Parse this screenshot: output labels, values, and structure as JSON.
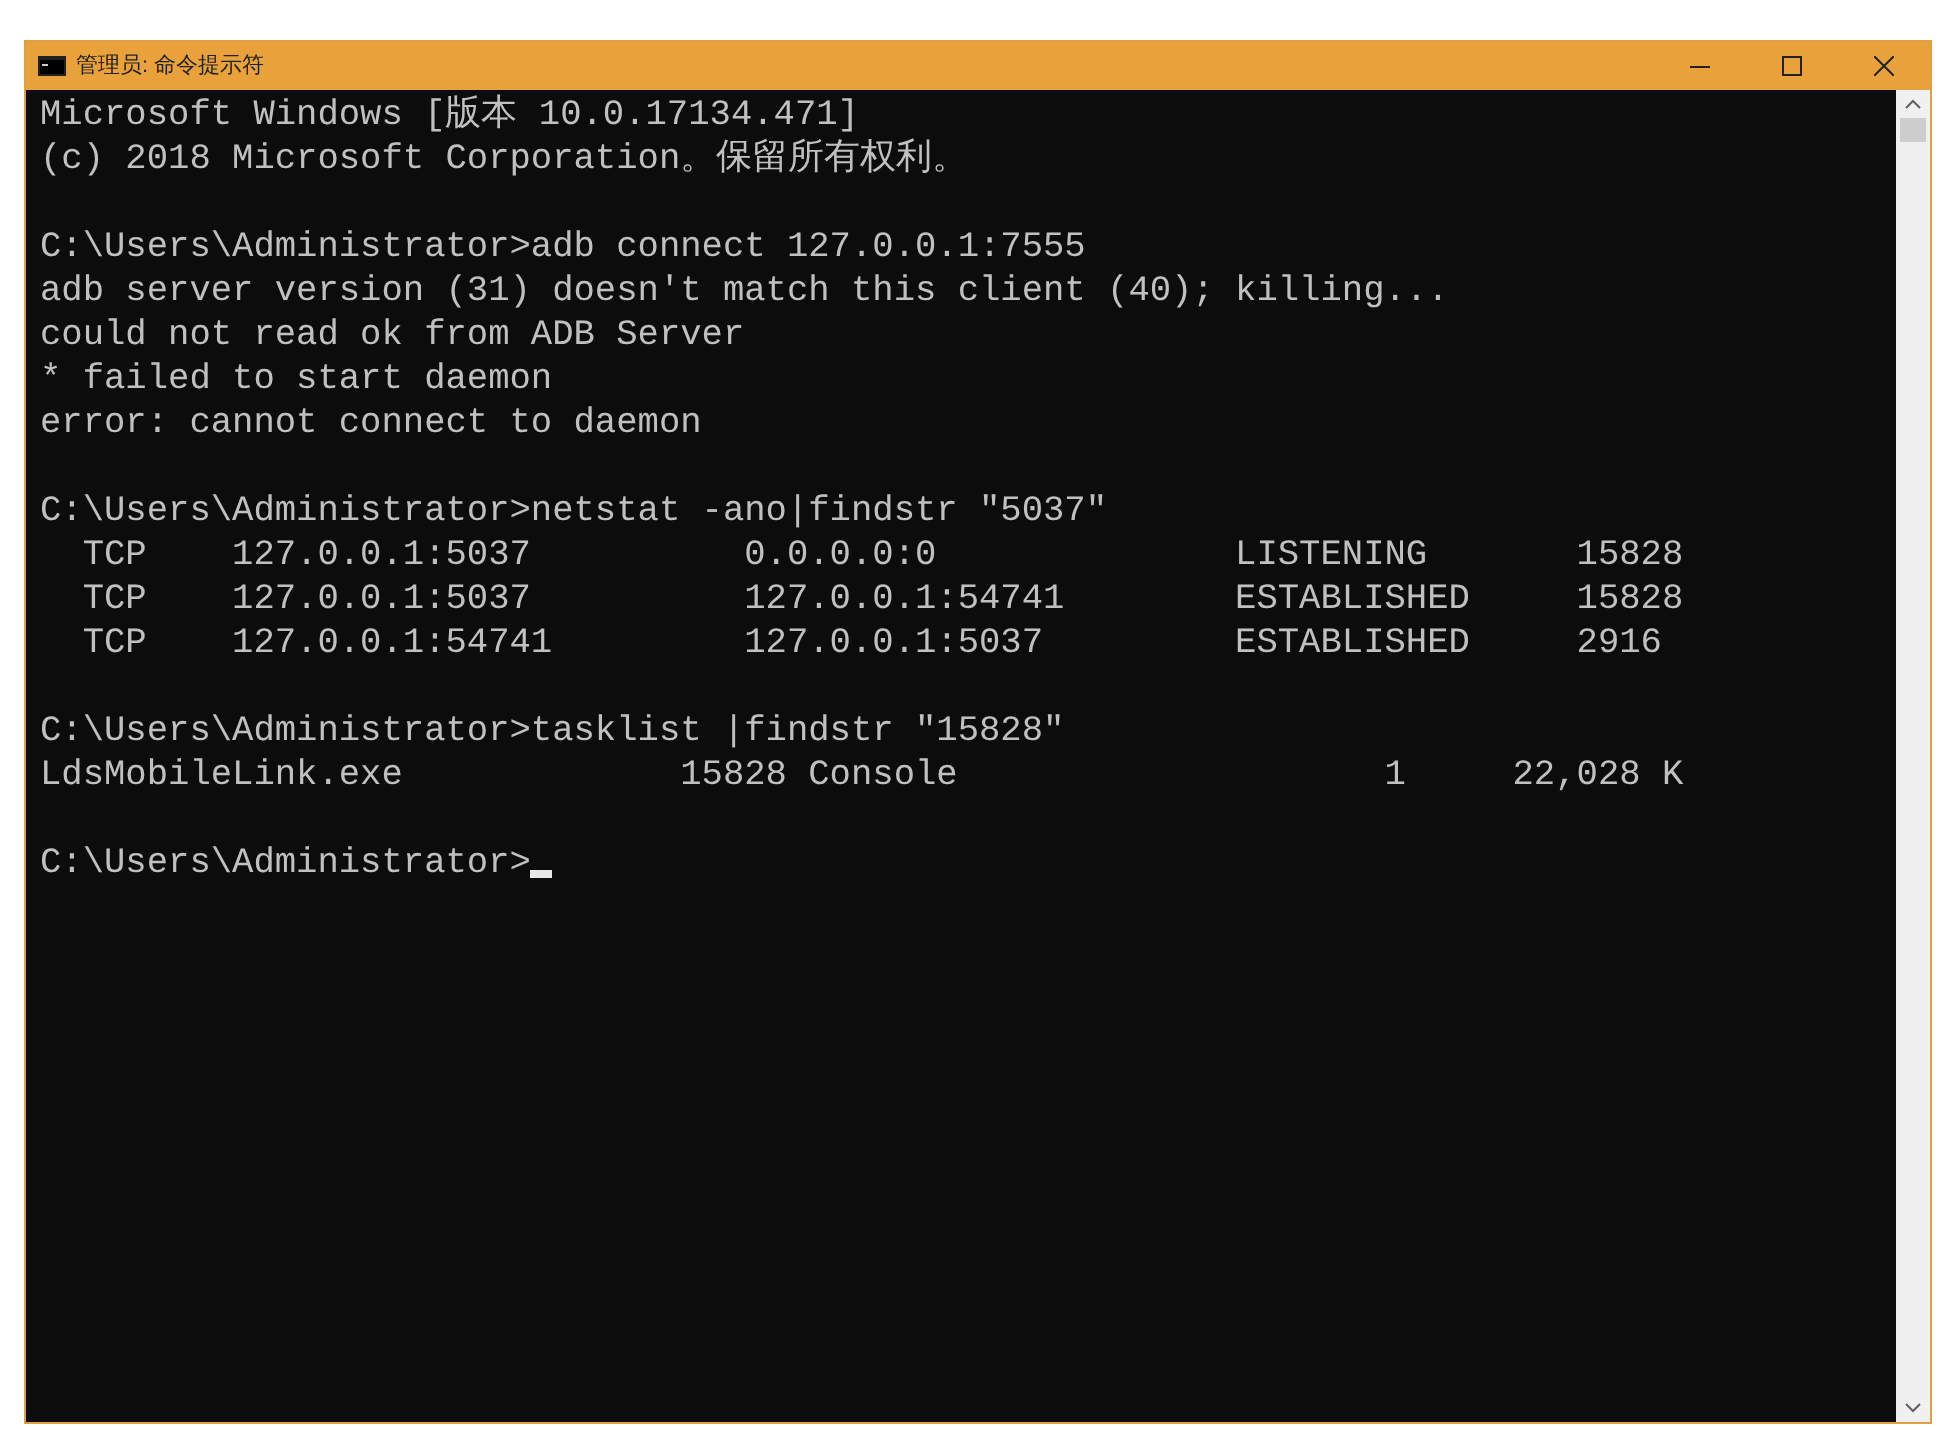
{
  "window": {
    "title": "管理员: 命令提示符"
  },
  "console": {
    "blocks": [
      {
        "lines": [
          "Microsoft Windows [版本 10.0.17134.471]",
          "(c) 2018 Microsoft Corporation。保留所有权利。"
        ]
      },
      {
        "lines": [
          "C:\\Users\\Administrator>adb connect 127.0.0.1:7555",
          "adb server version (31) doesn't match this client (40); killing...",
          "could not read ok from ADB Server",
          "* failed to start daemon",
          "error: cannot connect to daemon"
        ]
      },
      {
        "lines": [
          "C:\\Users\\Administrator>netstat -ano|findstr \"5037\"",
          "  TCP    127.0.0.1:5037          0.0.0.0:0              LISTENING       15828",
          "  TCP    127.0.0.1:5037          127.0.0.1:54741        ESTABLISHED     15828",
          "  TCP    127.0.0.1:54741         127.0.0.1:5037         ESTABLISHED     2916"
        ]
      },
      {
        "lines": [
          "C:\\Users\\Administrator>tasklist |findstr \"15828\"",
          "LdsMobileLink.exe             15828 Console                    1     22,028 K"
        ]
      },
      {
        "lines": [
          "C:\\Users\\Administrator>"
        ]
      }
    ],
    "cursor": true
  }
}
